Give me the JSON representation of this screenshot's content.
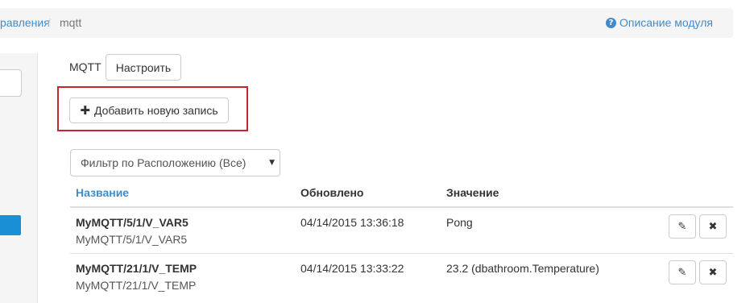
{
  "breadcrumb": {
    "link": "равления",
    "separator": "/",
    "current": "mqtt"
  },
  "help": {
    "icon": "question-circle-icon",
    "glyph": "?",
    "label": "Описание модуля"
  },
  "module": {
    "label": "MQTT",
    "configure_button": "Настроить"
  },
  "add_button": {
    "icon": "plus-icon",
    "glyph": "✚",
    "label": "Добавить новую запись"
  },
  "filter": {
    "selected": "Фильтр по Расположению (Все)",
    "caret": "▼"
  },
  "table": {
    "columns": [
      "Название",
      "Обновлено",
      "Значение"
    ],
    "rows": [
      {
        "title": "MyMQTT/5/1/V_VAR5",
        "subtitle": "MyMQTT/5/1/V_VAR5",
        "updated": "04/14/2015 13:36:18",
        "value": "Pong"
      },
      {
        "title": "MyMQTT/21/1/V_TEMP",
        "subtitle": "MyMQTT/21/1/V_TEMP",
        "updated": "04/14/2015 13:33:22",
        "value": "23.2 (dbathroom.Temperature)"
      }
    ],
    "edit_glyph": "✎",
    "delete_glyph": "✖"
  },
  "colors": {
    "link": "#428bca",
    "highlight_border": "#c0282d",
    "side_button": "#1a8fd6"
  }
}
